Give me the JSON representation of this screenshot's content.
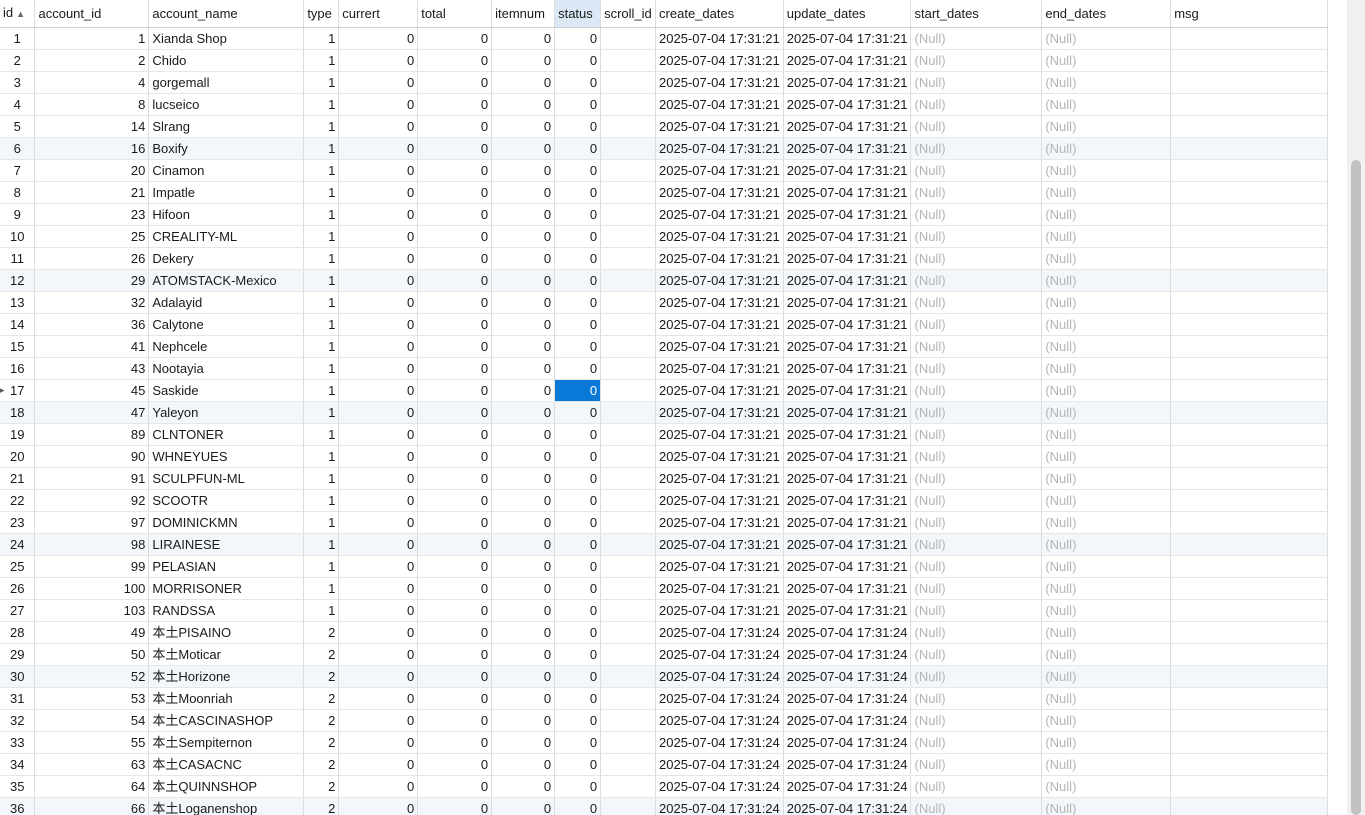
{
  "columns": [
    "id",
    "account_id",
    "account_name",
    "type",
    "currert",
    "total",
    "itemnum",
    "status",
    "scroll_id",
    "create_dates",
    "update_dates",
    "start_dates",
    "end_dates",
    "msg"
  ],
  "sorted_column": "id",
  "sort_icon": "sort-ascending-icon",
  "selected": {
    "row_id": 17,
    "column": "status"
  },
  "accent_color": "#0a78d7",
  "rows": [
    {
      "id": "1",
      "account_id": "1",
      "account_name": "Xianda Shop",
      "type": "1",
      "currert": "0",
      "total": "0",
      "itemnum": "0",
      "status": "0",
      "scroll_id": "",
      "create_dates": "2025-07-04 17:31:21",
      "update_dates": "2025-07-04 17:31:21",
      "start_dates": "(Null)",
      "end_dates": "(Null)",
      "msg": ""
    },
    {
      "id": "2",
      "account_id": "2",
      "account_name": "Chido",
      "type": "1",
      "currert": "0",
      "total": "0",
      "itemnum": "0",
      "status": "0",
      "scroll_id": "",
      "create_dates": "2025-07-04 17:31:21",
      "update_dates": "2025-07-04 17:31:21",
      "start_dates": "(Null)",
      "end_dates": "(Null)",
      "msg": ""
    },
    {
      "id": "3",
      "account_id": "4",
      "account_name": "gorgemall",
      "type": "1",
      "currert": "0",
      "total": "0",
      "itemnum": "0",
      "status": "0",
      "scroll_id": "",
      "create_dates": "2025-07-04 17:31:21",
      "update_dates": "2025-07-04 17:31:21",
      "start_dates": "(Null)",
      "end_dates": "(Null)",
      "msg": ""
    },
    {
      "id": "4",
      "account_id": "8",
      "account_name": "lucseico",
      "type": "1",
      "currert": "0",
      "total": "0",
      "itemnum": "0",
      "status": "0",
      "scroll_id": "",
      "create_dates": "2025-07-04 17:31:21",
      "update_dates": "2025-07-04 17:31:21",
      "start_dates": "(Null)",
      "end_dates": "(Null)",
      "msg": ""
    },
    {
      "id": "5",
      "account_id": "14",
      "account_name": "Slrang",
      "type": "1",
      "currert": "0",
      "total": "0",
      "itemnum": "0",
      "status": "0",
      "scroll_id": "",
      "create_dates": "2025-07-04 17:31:21",
      "update_dates": "2025-07-04 17:31:21",
      "start_dates": "(Null)",
      "end_dates": "(Null)",
      "msg": ""
    },
    {
      "id": "6",
      "account_id": "16",
      "account_name": "Boxify",
      "type": "1",
      "currert": "0",
      "total": "0",
      "itemnum": "0",
      "status": "0",
      "scroll_id": "",
      "create_dates": "2025-07-04 17:31:21",
      "update_dates": "2025-07-04 17:31:21",
      "start_dates": "(Null)",
      "end_dates": "(Null)",
      "msg": ""
    },
    {
      "id": "7",
      "account_id": "20",
      "account_name": "Cinamon",
      "type": "1",
      "currert": "0",
      "total": "0",
      "itemnum": "0",
      "status": "0",
      "scroll_id": "",
      "create_dates": "2025-07-04 17:31:21",
      "update_dates": "2025-07-04 17:31:21",
      "start_dates": "(Null)",
      "end_dates": "(Null)",
      "msg": ""
    },
    {
      "id": "8",
      "account_id": "21",
      "account_name": "Impatle",
      "type": "1",
      "currert": "0",
      "total": "0",
      "itemnum": "0",
      "status": "0",
      "scroll_id": "",
      "create_dates": "2025-07-04 17:31:21",
      "update_dates": "2025-07-04 17:31:21",
      "start_dates": "(Null)",
      "end_dates": "(Null)",
      "msg": ""
    },
    {
      "id": "9",
      "account_id": "23",
      "account_name": "Hifoon",
      "type": "1",
      "currert": "0",
      "total": "0",
      "itemnum": "0",
      "status": "0",
      "scroll_id": "",
      "create_dates": "2025-07-04 17:31:21",
      "update_dates": "2025-07-04 17:31:21",
      "start_dates": "(Null)",
      "end_dates": "(Null)",
      "msg": ""
    },
    {
      "id": "10",
      "account_id": "25",
      "account_name": "CREALITY-ML",
      "type": "1",
      "currert": "0",
      "total": "0",
      "itemnum": "0",
      "status": "0",
      "scroll_id": "",
      "create_dates": "2025-07-04 17:31:21",
      "update_dates": "2025-07-04 17:31:21",
      "start_dates": "(Null)",
      "end_dates": "(Null)",
      "msg": ""
    },
    {
      "id": "11",
      "account_id": "26",
      "account_name": "Dekery",
      "type": "1",
      "currert": "0",
      "total": "0",
      "itemnum": "0",
      "status": "0",
      "scroll_id": "",
      "create_dates": "2025-07-04 17:31:21",
      "update_dates": "2025-07-04 17:31:21",
      "start_dates": "(Null)",
      "end_dates": "(Null)",
      "msg": ""
    },
    {
      "id": "12",
      "account_id": "29",
      "account_name": "ATOMSTACK-Mexico",
      "type": "1",
      "currert": "0",
      "total": "0",
      "itemnum": "0",
      "status": "0",
      "scroll_id": "",
      "create_dates": "2025-07-04 17:31:21",
      "update_dates": "2025-07-04 17:31:21",
      "start_dates": "(Null)",
      "end_dates": "(Null)",
      "msg": ""
    },
    {
      "id": "13",
      "account_id": "32",
      "account_name": "Adalayid",
      "type": "1",
      "currert": "0",
      "total": "0",
      "itemnum": "0",
      "status": "0",
      "scroll_id": "",
      "create_dates": "2025-07-04 17:31:21",
      "update_dates": "2025-07-04 17:31:21",
      "start_dates": "(Null)",
      "end_dates": "(Null)",
      "msg": ""
    },
    {
      "id": "14",
      "account_id": "36",
      "account_name": "Calytone",
      "type": "1",
      "currert": "0",
      "total": "0",
      "itemnum": "0",
      "status": "0",
      "scroll_id": "",
      "create_dates": "2025-07-04 17:31:21",
      "update_dates": "2025-07-04 17:31:21",
      "start_dates": "(Null)",
      "end_dates": "(Null)",
      "msg": ""
    },
    {
      "id": "15",
      "account_id": "41",
      "account_name": "Nephcele",
      "type": "1",
      "currert": "0",
      "total": "0",
      "itemnum": "0",
      "status": "0",
      "scroll_id": "",
      "create_dates": "2025-07-04 17:31:21",
      "update_dates": "2025-07-04 17:31:21",
      "start_dates": "(Null)",
      "end_dates": "(Null)",
      "msg": ""
    },
    {
      "id": "16",
      "account_id": "43",
      "account_name": "Nootayia",
      "type": "1",
      "currert": "0",
      "total": "0",
      "itemnum": "0",
      "status": "0",
      "scroll_id": "",
      "create_dates": "2025-07-04 17:31:21",
      "update_dates": "2025-07-04 17:31:21",
      "start_dates": "(Null)",
      "end_dates": "(Null)",
      "msg": ""
    },
    {
      "id": "17",
      "account_id": "45",
      "account_name": "Saskide",
      "type": "1",
      "currert": "0",
      "total": "0",
      "itemnum": "0",
      "status": "0",
      "scroll_id": "",
      "create_dates": "2025-07-04 17:31:21",
      "update_dates": "2025-07-04 17:31:21",
      "start_dates": "(Null)",
      "end_dates": "(Null)",
      "msg": ""
    },
    {
      "id": "18",
      "account_id": "47",
      "account_name": "Yaleyon",
      "type": "1",
      "currert": "0",
      "total": "0",
      "itemnum": "0",
      "status": "0",
      "scroll_id": "",
      "create_dates": "2025-07-04 17:31:21",
      "update_dates": "2025-07-04 17:31:21",
      "start_dates": "(Null)",
      "end_dates": "(Null)",
      "msg": ""
    },
    {
      "id": "19",
      "account_id": "89",
      "account_name": "CLNTONER",
      "type": "1",
      "currert": "0",
      "total": "0",
      "itemnum": "0",
      "status": "0",
      "scroll_id": "",
      "create_dates": "2025-07-04 17:31:21",
      "update_dates": "2025-07-04 17:31:21",
      "start_dates": "(Null)",
      "end_dates": "(Null)",
      "msg": ""
    },
    {
      "id": "20",
      "account_id": "90",
      "account_name": "WHNEYUES",
      "type": "1",
      "currert": "0",
      "total": "0",
      "itemnum": "0",
      "status": "0",
      "scroll_id": "",
      "create_dates": "2025-07-04 17:31:21",
      "update_dates": "2025-07-04 17:31:21",
      "start_dates": "(Null)",
      "end_dates": "(Null)",
      "msg": ""
    },
    {
      "id": "21",
      "account_id": "91",
      "account_name": "SCULPFUN-ML",
      "type": "1",
      "currert": "0",
      "total": "0",
      "itemnum": "0",
      "status": "0",
      "scroll_id": "",
      "create_dates": "2025-07-04 17:31:21",
      "update_dates": "2025-07-04 17:31:21",
      "start_dates": "(Null)",
      "end_dates": "(Null)",
      "msg": ""
    },
    {
      "id": "22",
      "account_id": "92",
      "account_name": "SCOOTR",
      "type": "1",
      "currert": "0",
      "total": "0",
      "itemnum": "0",
      "status": "0",
      "scroll_id": "",
      "create_dates": "2025-07-04 17:31:21",
      "update_dates": "2025-07-04 17:31:21",
      "start_dates": "(Null)",
      "end_dates": "(Null)",
      "msg": ""
    },
    {
      "id": "23",
      "account_id": "97",
      "account_name": "DOMINICKMN",
      "type": "1",
      "currert": "0",
      "total": "0",
      "itemnum": "0",
      "status": "0",
      "scroll_id": "",
      "create_dates": "2025-07-04 17:31:21",
      "update_dates": "2025-07-04 17:31:21",
      "start_dates": "(Null)",
      "end_dates": "(Null)",
      "msg": ""
    },
    {
      "id": "24",
      "account_id": "98",
      "account_name": "LIRAINESE",
      "type": "1",
      "currert": "0",
      "total": "0",
      "itemnum": "0",
      "status": "0",
      "scroll_id": "",
      "create_dates": "2025-07-04 17:31:21",
      "update_dates": "2025-07-04 17:31:21",
      "start_dates": "(Null)",
      "end_dates": "(Null)",
      "msg": ""
    },
    {
      "id": "25",
      "account_id": "99",
      "account_name": "PELASIAN",
      "type": "1",
      "currert": "0",
      "total": "0",
      "itemnum": "0",
      "status": "0",
      "scroll_id": "",
      "create_dates": "2025-07-04 17:31:21",
      "update_dates": "2025-07-04 17:31:21",
      "start_dates": "(Null)",
      "end_dates": "(Null)",
      "msg": ""
    },
    {
      "id": "26",
      "account_id": "100",
      "account_name": "MORRISONER",
      "type": "1",
      "currert": "0",
      "total": "0",
      "itemnum": "0",
      "status": "0",
      "scroll_id": "",
      "create_dates": "2025-07-04 17:31:21",
      "update_dates": "2025-07-04 17:31:21",
      "start_dates": "(Null)",
      "end_dates": "(Null)",
      "msg": ""
    },
    {
      "id": "27",
      "account_id": "103",
      "account_name": "RANDSSA",
      "type": "1",
      "currert": "0",
      "total": "0",
      "itemnum": "0",
      "status": "0",
      "scroll_id": "",
      "create_dates": "2025-07-04 17:31:21",
      "update_dates": "2025-07-04 17:31:21",
      "start_dates": "(Null)",
      "end_dates": "(Null)",
      "msg": ""
    },
    {
      "id": "28",
      "account_id": "49",
      "account_name": "本土PISAINO",
      "type": "2",
      "currert": "0",
      "total": "0",
      "itemnum": "0",
      "status": "0",
      "scroll_id": "",
      "create_dates": "2025-07-04 17:31:24",
      "update_dates": "2025-07-04 17:31:24",
      "start_dates": "(Null)",
      "end_dates": "(Null)",
      "msg": ""
    },
    {
      "id": "29",
      "account_id": "50",
      "account_name": "本土Moticar",
      "type": "2",
      "currert": "0",
      "total": "0",
      "itemnum": "0",
      "status": "0",
      "scroll_id": "",
      "create_dates": "2025-07-04 17:31:24",
      "update_dates": "2025-07-04 17:31:24",
      "start_dates": "(Null)",
      "end_dates": "(Null)",
      "msg": ""
    },
    {
      "id": "30",
      "account_id": "52",
      "account_name": "本土Horizone",
      "type": "2",
      "currert": "0",
      "total": "0",
      "itemnum": "0",
      "status": "0",
      "scroll_id": "",
      "create_dates": "2025-07-04 17:31:24",
      "update_dates": "2025-07-04 17:31:24",
      "start_dates": "(Null)",
      "end_dates": "(Null)",
      "msg": ""
    },
    {
      "id": "31",
      "account_id": "53",
      "account_name": "本土Moonriah",
      "type": "2",
      "currert": "0",
      "total": "0",
      "itemnum": "0",
      "status": "0",
      "scroll_id": "",
      "create_dates": "2025-07-04 17:31:24",
      "update_dates": "2025-07-04 17:31:24",
      "start_dates": "(Null)",
      "end_dates": "(Null)",
      "msg": ""
    },
    {
      "id": "32",
      "account_id": "54",
      "account_name": "本土CASCINASHOP",
      "type": "2",
      "currert": "0",
      "total": "0",
      "itemnum": "0",
      "status": "0",
      "scroll_id": "",
      "create_dates": "2025-07-04 17:31:24",
      "update_dates": "2025-07-04 17:31:24",
      "start_dates": "(Null)",
      "end_dates": "(Null)",
      "msg": ""
    },
    {
      "id": "33",
      "account_id": "55",
      "account_name": "本土Sempiternon",
      "type": "2",
      "currert": "0",
      "total": "0",
      "itemnum": "0",
      "status": "0",
      "scroll_id": "",
      "create_dates": "2025-07-04 17:31:24",
      "update_dates": "2025-07-04 17:31:24",
      "start_dates": "(Null)",
      "end_dates": "(Null)",
      "msg": ""
    },
    {
      "id": "34",
      "account_id": "63",
      "account_name": "本土CASACNC",
      "type": "2",
      "currert": "0",
      "total": "0",
      "itemnum": "0",
      "status": "0",
      "scroll_id": "",
      "create_dates": "2025-07-04 17:31:24",
      "update_dates": "2025-07-04 17:31:24",
      "start_dates": "(Null)",
      "end_dates": "(Null)",
      "msg": ""
    },
    {
      "id": "35",
      "account_id": "64",
      "account_name": "本土QUINNSHOP",
      "type": "2",
      "currert": "0",
      "total": "0",
      "itemnum": "0",
      "status": "0",
      "scroll_id": "",
      "create_dates": "2025-07-04 17:31:24",
      "update_dates": "2025-07-04 17:31:24",
      "start_dates": "(Null)",
      "end_dates": "(Null)",
      "msg": ""
    },
    {
      "id": "36",
      "account_id": "66",
      "account_name": "本土Loganenshop",
      "type": "2",
      "currert": "0",
      "total": "0",
      "itemnum": "0",
      "status": "0",
      "scroll_id": "",
      "create_dates": "2025-07-04 17:31:24",
      "update_dates": "2025-07-04 17:31:24",
      "start_dates": "(Null)",
      "end_dates": "(Null)",
      "msg": ""
    }
  ]
}
